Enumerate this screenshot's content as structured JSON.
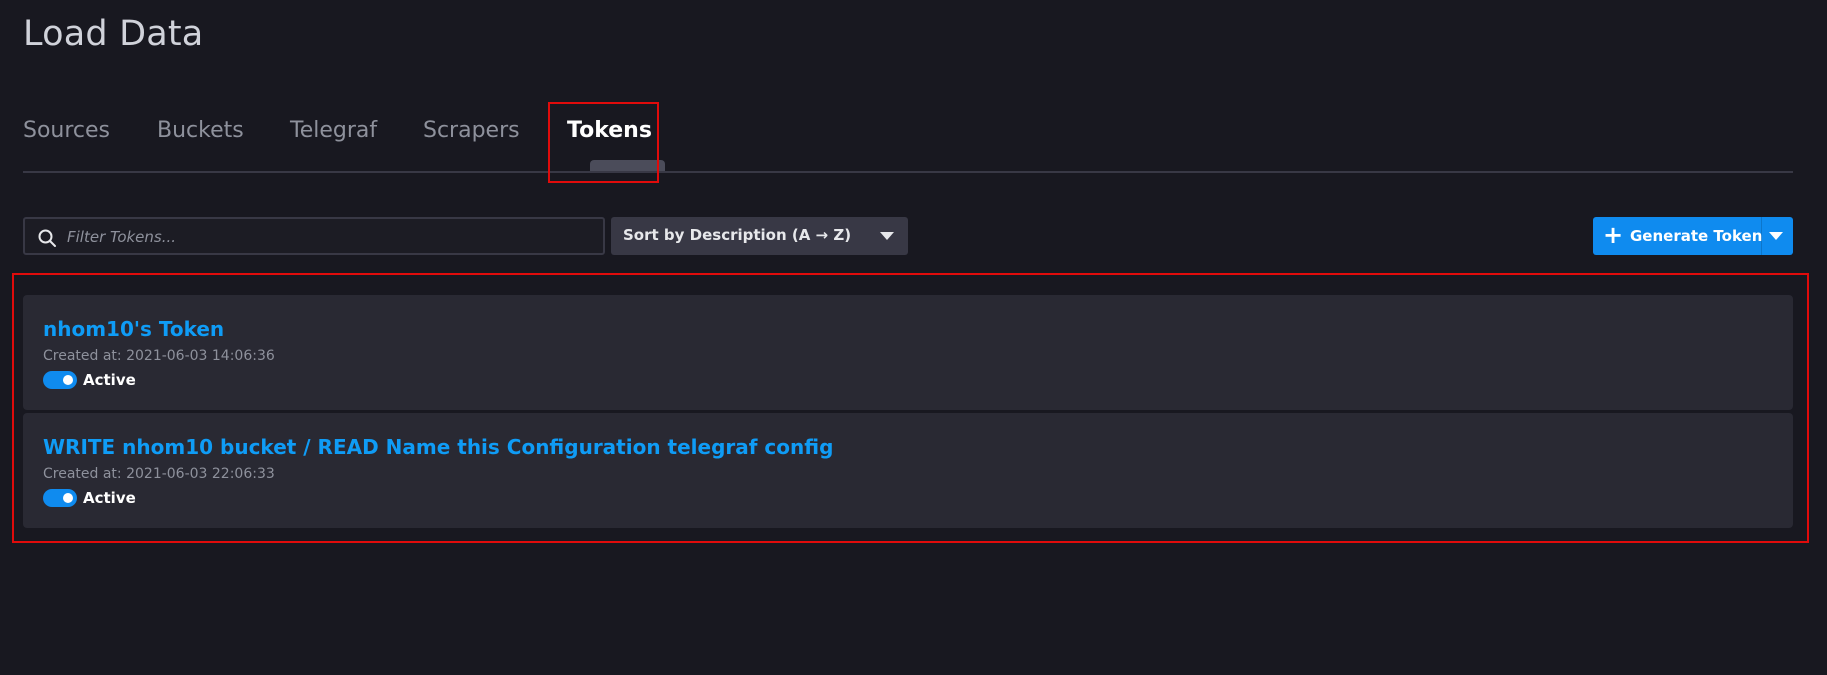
{
  "page": {
    "title": "Load Data"
  },
  "tabs": [
    {
      "label": "Sources",
      "active": false
    },
    {
      "label": "Buckets",
      "active": false
    },
    {
      "label": "Telegraf",
      "active": false
    },
    {
      "label": "Scrapers",
      "active": false
    },
    {
      "label": "Tokens",
      "active": true
    }
  ],
  "toolbar": {
    "search_placeholder": "Filter Tokens...",
    "sort_label": "Sort by Description (A → Z)",
    "generate_label": "Generate Token"
  },
  "tokens": [
    {
      "name": "nhom10's Token",
      "created": "Created at: 2021-06-03 14:06:36",
      "status": "Active"
    },
    {
      "name": "WRITE nhom10 bucket / READ Name this Configuration telegraf config",
      "created": "Created at: 2021-06-03 22:06:33",
      "status": "Active"
    }
  ],
  "colors": {
    "background": "#181820",
    "accent": "#0f8bef",
    "link": "#0f9cf6",
    "highlight": "#e00b0b"
  },
  "icons": {
    "search": "search-icon",
    "plus": "plus-icon",
    "caret": "chevron-down-icon"
  }
}
